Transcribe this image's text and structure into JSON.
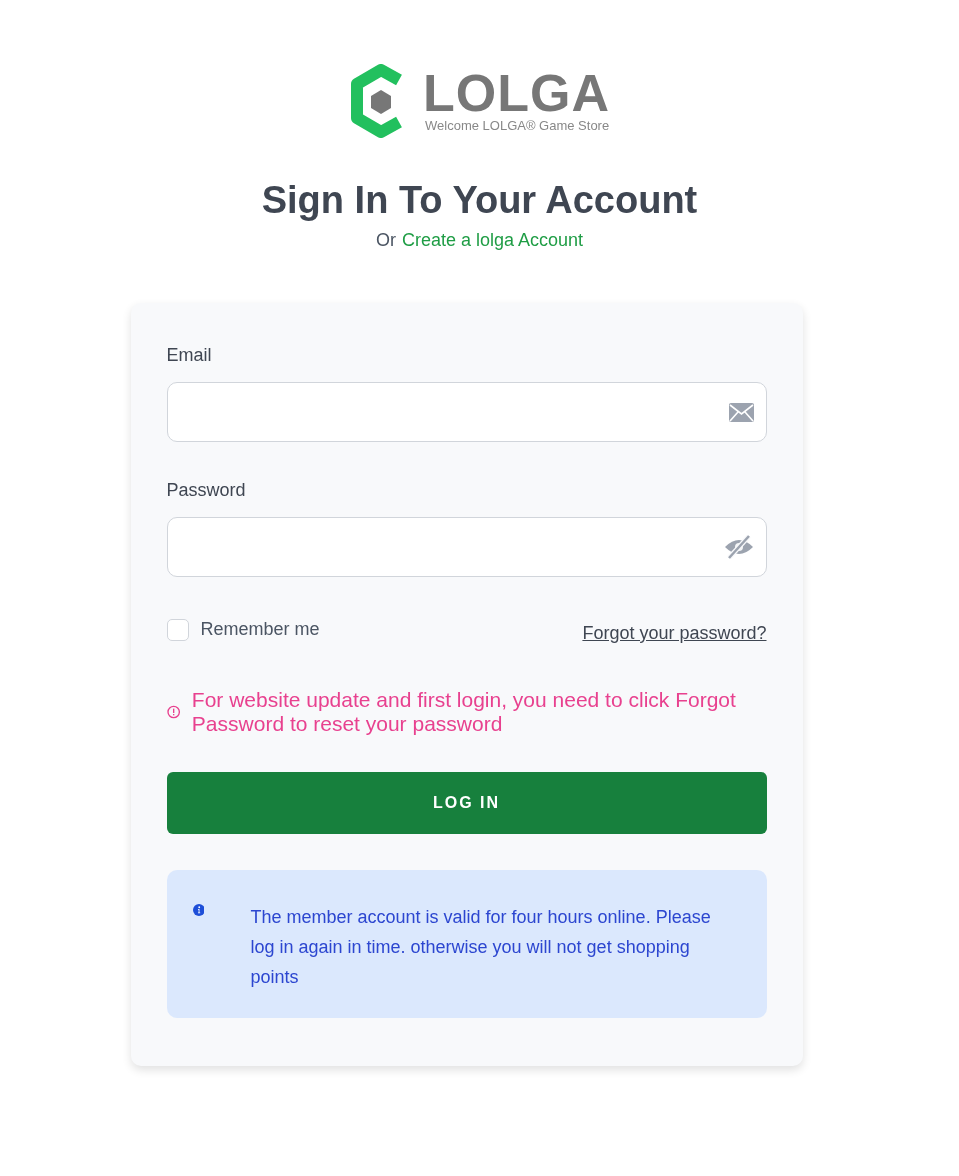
{
  "logo": {
    "name": "LOLGA",
    "tagline": "Welcome LOLGA® Game Store"
  },
  "heading": {
    "title": "Sign In To Your Account",
    "prefix": "Or",
    "link": "Create a lolga Account"
  },
  "form": {
    "fields": [
      {
        "label": "Email",
        "kind": "email"
      },
      {
        "label": "Password",
        "kind": "password"
      }
    ],
    "remember": {
      "label": "Remember me",
      "checked": false
    },
    "forgot_link": "Forgot your password?",
    "warning": "For website update and first login, you need to click Forgot Password to reset your password",
    "submit": "LOG IN",
    "info": "The member account is valid for four hours online. Please log in again in time. otherwise you will not get shopping points"
  }
}
